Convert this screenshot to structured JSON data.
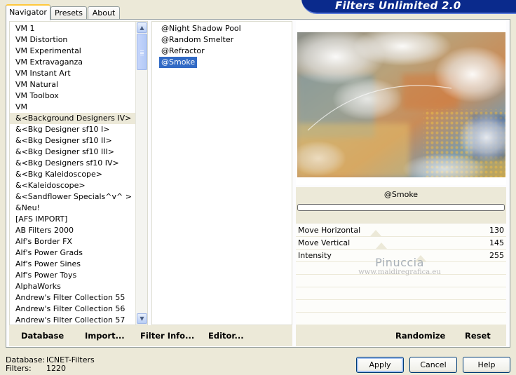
{
  "tabs": [
    "Navigator",
    "Presets",
    "About"
  ],
  "app_title": "Filters Unlimited 2.0",
  "categories": [
    "VM 1",
    "VM Distortion",
    "VM Experimental",
    "VM Extravaganza",
    "VM Instant Art",
    "VM Natural",
    "VM Toolbox",
    "VM",
    "&<Background Designers IV>",
    "&<Bkg Designer sf10 I>",
    "&<Bkg Designer sf10 II>",
    "&<Bkg Designer sf10 III>",
    "&<Bkg Designers sf10 IV>",
    "&<Bkg Kaleidoscope>",
    "&<Kaleidoscope>",
    "&<Sandflower Specials^v^ >",
    "&Neu!",
    "[AFS IMPORT]",
    "AB Filters 2000",
    "Alf's Border FX",
    "Alf's Power Grads",
    "Alf's Power Sines",
    "Alf's Power Toys",
    "AlphaWorks",
    "Andrew's Filter Collection 55",
    "Andrew's Filter Collection 56",
    "Andrew's Filter Collection 57"
  ],
  "selected_category": "&<Background Designers IV>",
  "filters": [
    "@Night Shadow Pool",
    "@Random Smelter",
    "@Refractor",
    "@Smoke"
  ],
  "selected_filter": "@Smoke",
  "left_buttons": [
    "Database",
    "Import...",
    "Filter Info...",
    "Editor..."
  ],
  "preview_filter_name": "@Smoke",
  "progress": 0,
  "params": [
    {
      "label": "Move Horizontal",
      "value": "130",
      "level": 130
    },
    {
      "label": "Move Vertical",
      "value": "145",
      "level": 145
    },
    {
      "label": "Intensity",
      "value": "255",
      "level": 255
    }
  ],
  "watermark": {
    "name": "Pinuccia",
    "url": "www.maidiregrafica.eu"
  },
  "right_buttons": [
    "Randomize",
    "Reset"
  ],
  "footer": {
    "database_label": "Database:",
    "database_value": "ICNET-Filters",
    "filters_label": "Filters:",
    "filters_value": "1220"
  },
  "dialog_buttons": [
    "Apply",
    "Cancel",
    "Help"
  ],
  "colors": {
    "accent": "#316ac5",
    "banner": "#0a2a8c",
    "tab_highlight": "#ffc83c"
  }
}
